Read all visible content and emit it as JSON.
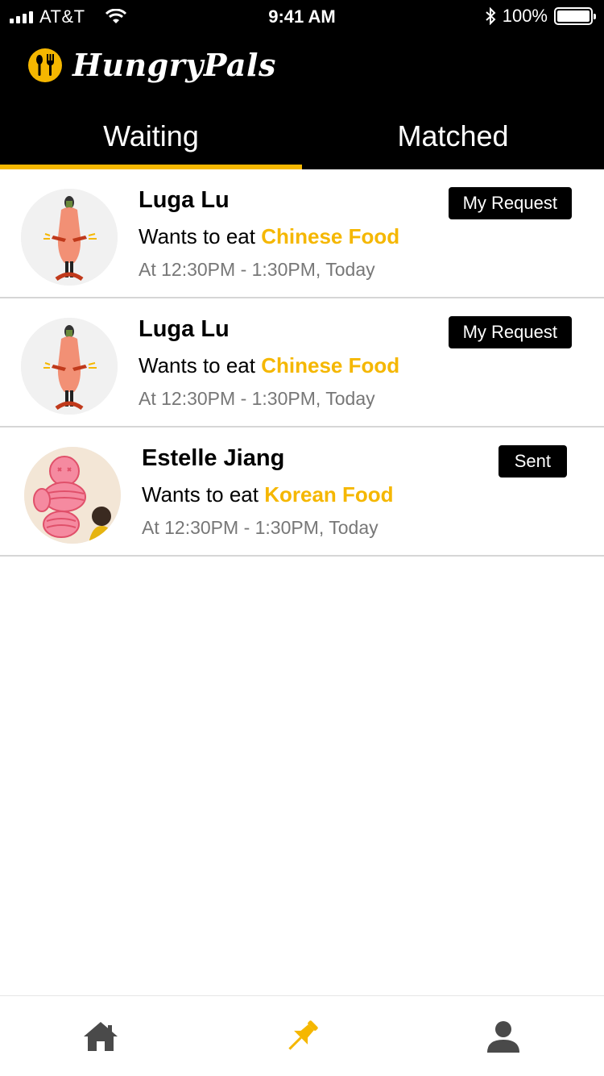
{
  "status": {
    "carrier": "AT&T",
    "time": "9:41 AM",
    "battery": "100%"
  },
  "app": {
    "name": "HungryPals"
  },
  "tabs": [
    {
      "label": "Waiting",
      "active": true
    },
    {
      "label": "Matched",
      "active": false
    }
  ],
  "requests": [
    {
      "name": "Luga Lu",
      "wants_prefix": "Wants to eat",
      "food": "Chinese Food",
      "time": "At 12:30PM - 1:30PM, Today",
      "badge": "My Request"
    },
    {
      "name": "Luga Lu",
      "wants_prefix": "Wants to eat",
      "food": "Chinese Food",
      "time": "At 12:30PM - 1:30PM, Today",
      "badge": "My Request"
    },
    {
      "name": "Estelle Jiang",
      "wants_prefix": "Wants to eat",
      "food": "Korean Food",
      "time": "At 12:30PM - 1:30PM, Today",
      "badge": "Sent"
    }
  ],
  "nav": {
    "items": [
      {
        "icon": "home-icon",
        "active": false
      },
      {
        "icon": "pin-icon",
        "active": true
      },
      {
        "icon": "user-icon",
        "active": false
      }
    ]
  },
  "colors": {
    "accent": "#f5b700",
    "header_bg": "#000000",
    "muted_text": "#777777",
    "nav_icon": "#4a4a4a"
  }
}
